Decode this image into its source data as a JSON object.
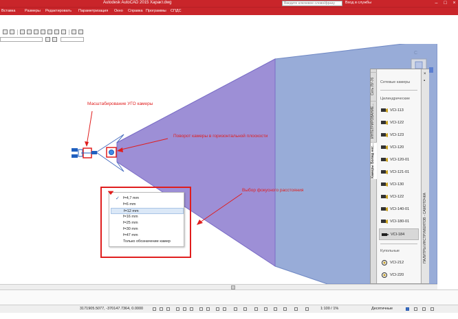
{
  "titlebar": {
    "title": "Autodesk AutoCAD 2015   Характ.dwg",
    "search_placeholder": "Введите ключевое слово/фразу",
    "user_label": "Вход в службы"
  },
  "menu": [
    "Вставка",
    "Размеры",
    "Редактировать",
    "Параметризация",
    "Окно",
    "Справка",
    "Программы",
    "СПДС"
  ],
  "annotations": {
    "scale": "Масштабирование УГО камеры",
    "rotate": "Поворот камеры в горизонтальной плоскости",
    "focal": "Выбор фокусного расстояния"
  },
  "dropdown": {
    "items": [
      "f=4,7 mm",
      "f=6 mm",
      "f=12 mm",
      "f=16 mm",
      "f=25 mm",
      "f=30 mm",
      "f=47 mm",
      "Только обозначение камер"
    ],
    "checked_index": 0,
    "selected_index": 2
  },
  "palette": {
    "tabs": [
      "Сеть ЛУ-76",
      "ИНТЕГРИРОВАНИЕ...",
      "Камеры Болид нес..."
    ],
    "side_title": "ПАЛИТРЫ ИНСТРУМЕНТОВ - САМОТОЧКА",
    "sections": {
      "network": "Сетевые камеры",
      "cylindrical": "Цилиндрические",
      "dome": "Купольные"
    },
    "cylindrical_cameras": [
      "VCI-113",
      "VCI-122",
      "VCI-123",
      "VCI-120",
      "VCI-120-01",
      "VCI-121-01",
      "VCI-130",
      "VCI-122",
      "VCI-140-01",
      "VCI-180-01",
      "VCI-184"
    ],
    "selected_camera_index": 10,
    "dome_cameras": [
      "VCI-212",
      "VCI-220"
    ]
  },
  "viewcube": {
    "label": "С"
  },
  "statusbar": {
    "coords": "3171905.5077, -370147.7364, 0.0000",
    "scale": "1:100 / 1%",
    "units": "Десятичные"
  },
  "colors": {
    "title_red": "#c9252a",
    "annotation_red": "#e01d1d",
    "fov_purple": "#9d8fd6",
    "fov_blue": "#98acd8"
  }
}
